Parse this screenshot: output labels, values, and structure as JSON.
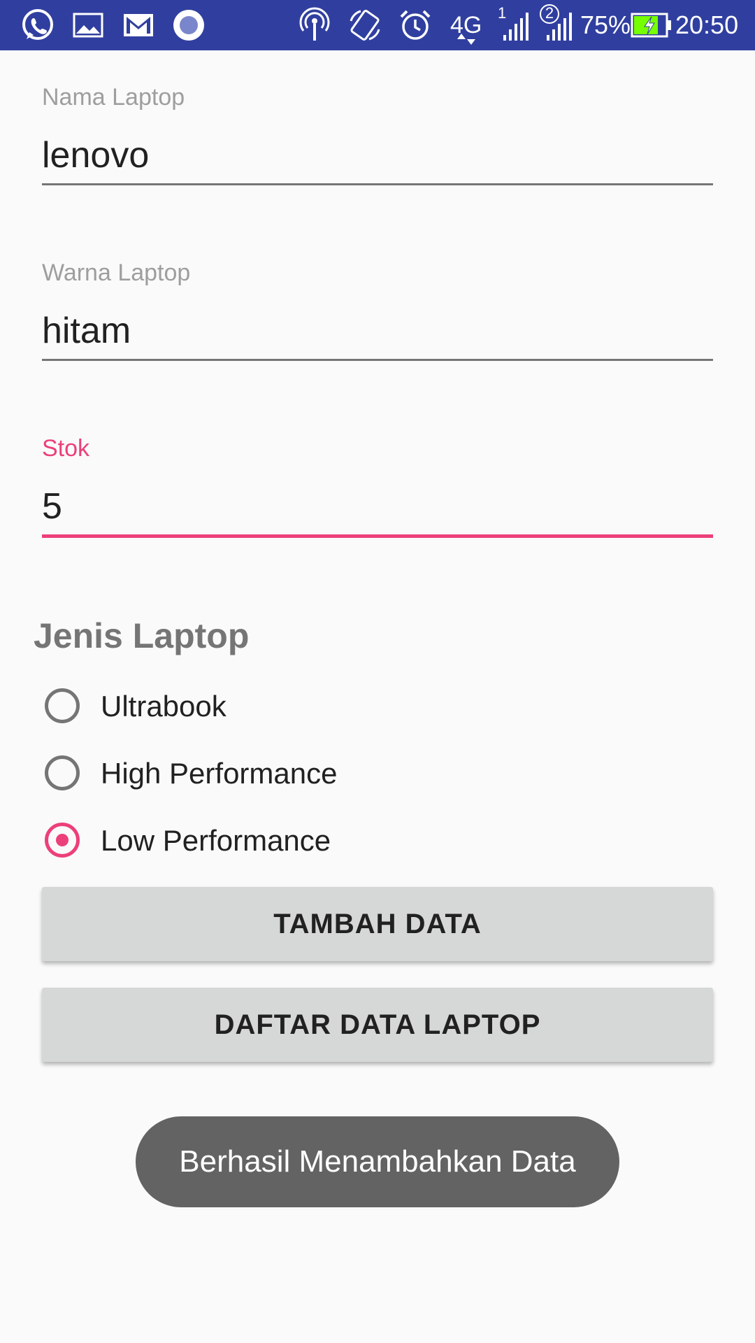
{
  "status_bar": {
    "battery_percent": "75%",
    "time": "20:50",
    "network": "4G",
    "sim1": "1",
    "sim2": "2",
    "icons": [
      "whatsapp-icon",
      "gallery-icon",
      "gmail-icon",
      "circle-app-icon",
      "hotspot-icon",
      "rotate-icon",
      "alarm-icon",
      "network-4g-icon",
      "signal-sim1-icon",
      "signal-sim2-icon",
      "battery-charging-icon"
    ],
    "background_color": "#303f9f"
  },
  "form": {
    "nama": {
      "label": "Nama Laptop",
      "value": "lenovo"
    },
    "warna": {
      "label": "Warna Laptop",
      "value": "hitam"
    },
    "stok": {
      "label": "Stok",
      "value": "5"
    }
  },
  "jenis": {
    "title": "Jenis Laptop",
    "options": [
      {
        "label": "Ultrabook",
        "checked": false
      },
      {
        "label": "High Performance",
        "checked": false
      },
      {
        "label": "Low Performance",
        "checked": true
      }
    ]
  },
  "buttons": {
    "tambah": "TAMBAH DATA",
    "daftar": "DAFTAR DATA LAPTOP"
  },
  "toast": {
    "message": "Berhasil Menambahkan Data"
  },
  "colors": {
    "accent": "#ec407a",
    "primary_dark": "#303f9f",
    "button_bg": "#d6d7d7",
    "toast_bg": "#636363"
  }
}
